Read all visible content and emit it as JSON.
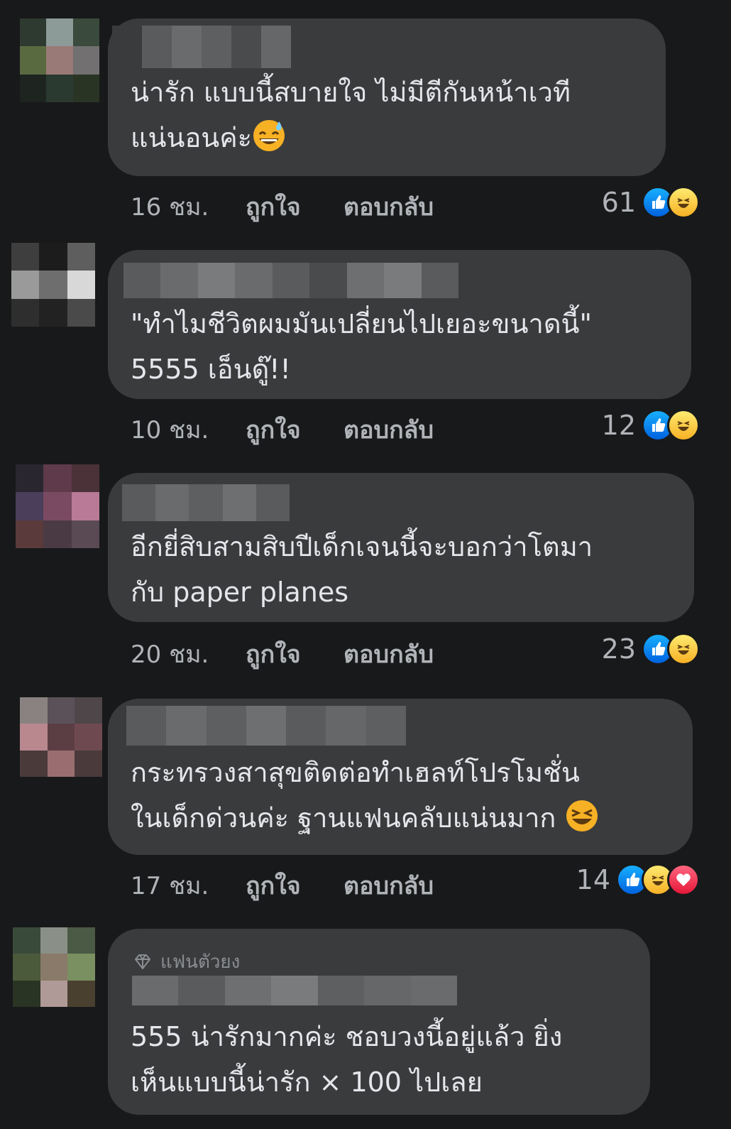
{
  "actions": {
    "like_label": "ถูกใจ",
    "reply_label": "ตอบกลับ"
  },
  "comments": [
    {
      "text": "น่ารัก แบบนี้สบายใจ ไม่มีตีกันหน้าเวที\nแน่นอนค่ะ",
      "emoji": "grinning-sweat-emoji",
      "time": "16 ชม.",
      "reaction_count": "61",
      "reactions": [
        "like-icon",
        "haha-icon"
      ],
      "avatar_colors": [
        "#2e3a30",
        "#8c9a98",
        "#3a4a3c",
        "#5a6a40",
        "#9a7a76",
        "#727070",
        "#1e2420",
        "#2a3a30",
        "#2a3424"
      ],
      "name_blur_colors": [
        "#3a3b3c",
        "#5a5b5c",
        "#6a6b6c",
        "#5e5f60",
        "#4a4b4c",
        "#666768"
      ]
    },
    {
      "text": "\"ทำไมชีวิตผมมันเปลี่ยนไปเยอะขนาดนี้\"\n5555 เอ็นดู๊!!",
      "time": "10 ชม.",
      "reaction_count": "12",
      "reactions": [
        "like-icon",
        "haha-icon"
      ],
      "avatar_colors": [
        "#3e3e3e",
        "#1c1c1c",
        "#5e5e5e",
        "#9a9a9a",
        "#6e6e6e",
        "#d8d8d8",
        "#2e2e2e",
        "#222222",
        "#4a4a4a"
      ],
      "name_blur_colors": [
        "#5a5b5c",
        "#6a6b6c",
        "#7a7b7c",
        "#6a6b6c",
        "#5a5b5c",
        "#4a4b4c",
        "#6e6f70",
        "#7a7b7c",
        "#5a5b5c"
      ]
    },
    {
      "text": "อีกยี่สิบสามสิบปีเด็กเจนนี้จะบอกว่าโตมา\nกับ paper planes",
      "time": "20 ชม.",
      "reaction_count": "23",
      "reactions": [
        "like-icon",
        "haha-icon"
      ],
      "avatar_colors": [
        "#2a2630",
        "#5e3a4a",
        "#4a3238",
        "#4a3e5a",
        "#7a4a62",
        "#b87a96",
        "#5a3a3a",
        "#4a3a44",
        "#5a4a54"
      ],
      "name_blur_colors": [
        "#5a5b5c",
        "#6a6b6c",
        "#5e5f60",
        "#6e6f70",
        "#5a5b5c"
      ]
    },
    {
      "text": "กระทรวงสาสุขติดต่อทำเฮลท์โปรโมชั่น\nในเด็กด่วนค่ะ ฐานแฟนคลับแน่นมาก ",
      "emoji": "laughing-emoji",
      "time": "17 ชม.",
      "reaction_count": "14",
      "reactions": [
        "like-icon",
        "haha-icon",
        "love-icon"
      ],
      "avatar_colors": [
        "#8a8280",
        "#5a5258",
        "#4e4648",
        "#b8888e",
        "#5a3e44",
        "#6e4a50",
        "#4a3a3a",
        "#9a6e70",
        "#4a3a3c"
      ],
      "name_blur_colors": [
        "#5a5b5c",
        "#6a6b6c",
        "#5e5f60",
        "#6e6f70",
        "#5a5b5c",
        "#666768",
        "#5e5f60"
      ]
    },
    {
      "badge": "แฟนตัวยง",
      "text": "555 น่ารักมากค่ะ ชอบวงนี้อยู่แล้ว ยิ่ง\nเห็นแบบนี้น่ารัก × 100 ไปเลย",
      "avatar_colors": [
        "#3a4a3a",
        "#8a9088",
        "#4a5a44",
        "#4a5a3a",
        "#8a7a6a",
        "#7a9060",
        "#2a3424",
        "#b09a98",
        "#4a4030"
      ],
      "name_blur_colors": [
        "#6a6b6c",
        "#5a5b5c",
        "#6e6f70",
        "#7a7b7c",
        "#5e5f60",
        "#666768",
        "#6a6b6c"
      ]
    }
  ]
}
